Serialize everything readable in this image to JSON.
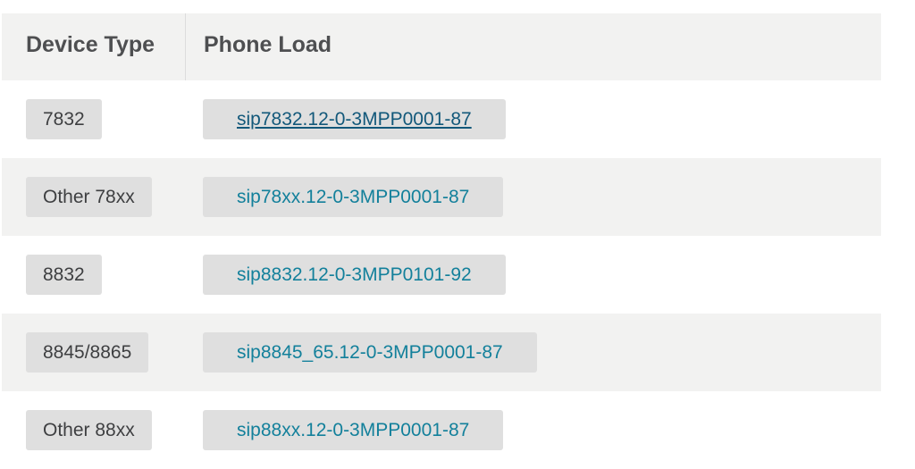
{
  "table": {
    "headers": {
      "device_type": "Device Type",
      "phone_load": "Phone Load"
    },
    "rows": [
      {
        "device_type": "7832",
        "phone_load": "sip7832.12-0-3MPP0001-87",
        "link_state": "hover-underlined"
      },
      {
        "device_type": "Other 78xx",
        "phone_load": "sip78xx.12-0-3MPP0001-87",
        "link_state": "normal"
      },
      {
        "device_type": "8832",
        "phone_load": "sip8832.12-0-3MPP0101-92",
        "link_state": "normal"
      },
      {
        "device_type": "8845/8865",
        "phone_load": "sip8845_65.12-0-3MPP0001-87",
        "link_state": "normal"
      },
      {
        "device_type": "Other 88xx",
        "phone_load": "sip88xx.12-0-3MPP0001-87",
        "link_state": "normal"
      }
    ]
  },
  "colors": {
    "header_bg": "#f2f2f1",
    "alt_row_bg": "#f2f2f1",
    "chip_bg": "#dfdfdf",
    "link": "#13809b",
    "link_active": "#12587a",
    "text": "#3e3f41"
  }
}
